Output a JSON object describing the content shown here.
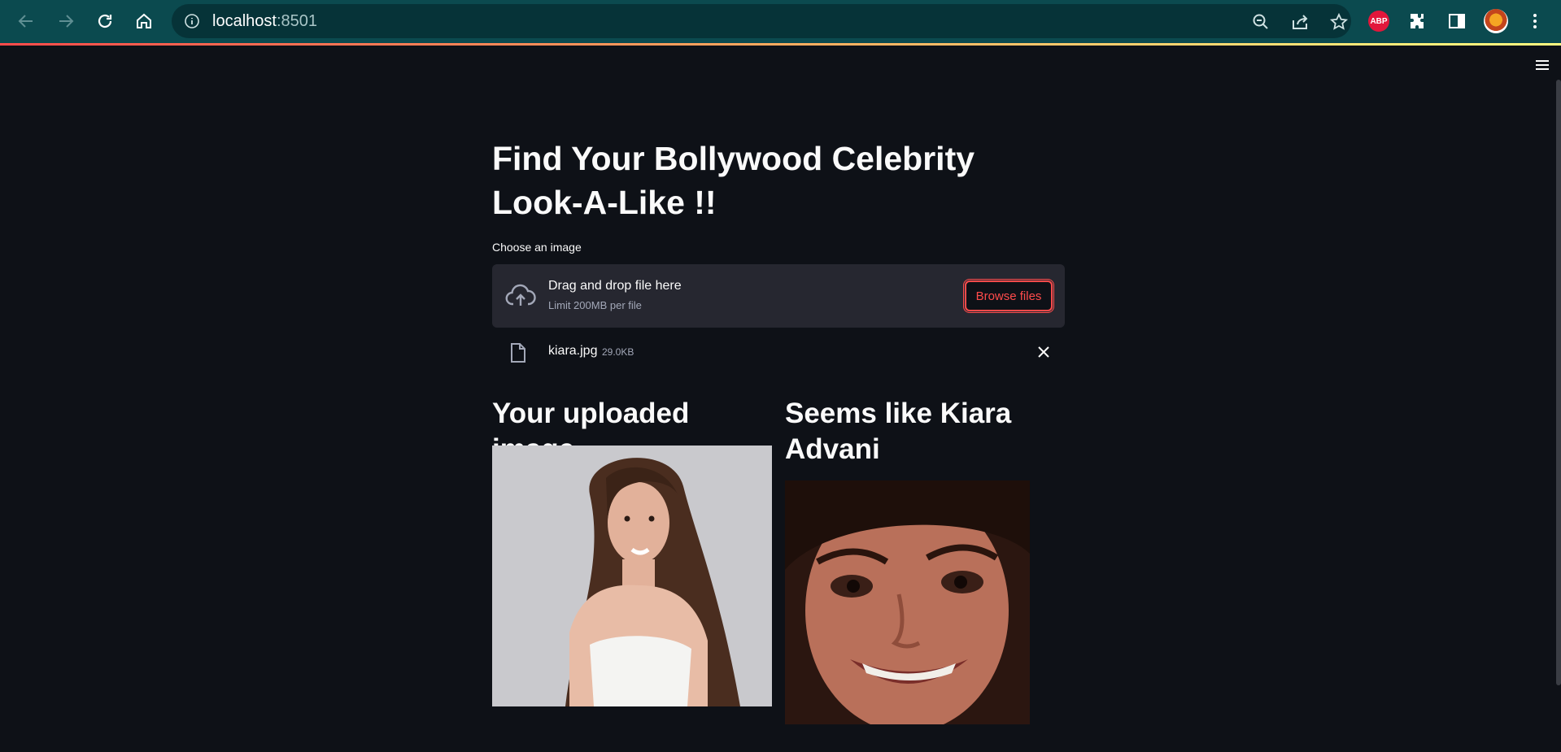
{
  "browser": {
    "url_host": "localhost",
    "url_port": ":8501",
    "extension_abp": "ABP"
  },
  "page": {
    "title": "Find Your Bollywood Celebrity Look-A-Like !!",
    "uploader_label": "Choose an image",
    "dropzone_title": "Drag and drop file here",
    "dropzone_limit": "Limit 200MB per file",
    "browse_button": "Browse files",
    "uploaded_file_name": "kiara.jpg",
    "uploaded_file_size": "29.0KB",
    "col1_heading": "Your uploaded image",
    "col2_heading": "Seems like Kiara Advani"
  },
  "colors": {
    "toolbar": "#0b4a4f",
    "background": "#0e1117",
    "dropzone": "#262730",
    "accent": "#ff4b4b"
  },
  "icons": [
    "back-icon",
    "forward-icon",
    "reload-icon",
    "home-icon",
    "info-icon",
    "zoom-out-icon",
    "share-icon",
    "star-icon",
    "abp-icon",
    "extensions-icon",
    "side-panel-icon",
    "profile-avatar",
    "kebab-menu-icon",
    "hamburger-icon",
    "cloud-upload-icon",
    "file-icon",
    "close-icon"
  ]
}
